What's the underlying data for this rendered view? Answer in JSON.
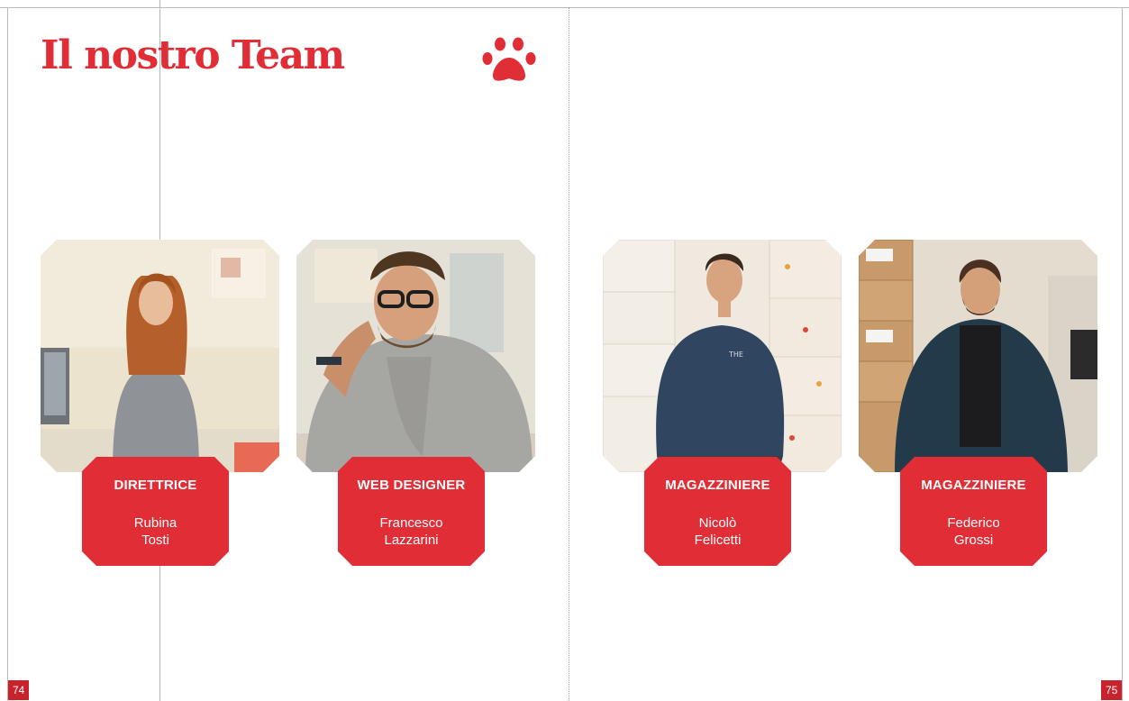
{
  "title": "Il nostro Team",
  "icons": {
    "paw": "paw-icon"
  },
  "colors": {
    "accent": "#e02d36",
    "page_number_bg": "#c8232c"
  },
  "team": [
    {
      "role": "DIRETTRICE",
      "first_name": "Rubina",
      "last_name": "Tosti"
    },
    {
      "role": "WEB DESIGNER",
      "first_name": "Francesco",
      "last_name": "Lazzarini"
    },
    {
      "role": "MAGAZZINIERE",
      "first_name": "Nicolò",
      "last_name": "Felicetti"
    },
    {
      "role": "MAGAZZINIERE",
      "first_name": "Federico",
      "last_name": "Grossi"
    }
  ],
  "page_numbers": {
    "left": "74",
    "right": "75"
  }
}
